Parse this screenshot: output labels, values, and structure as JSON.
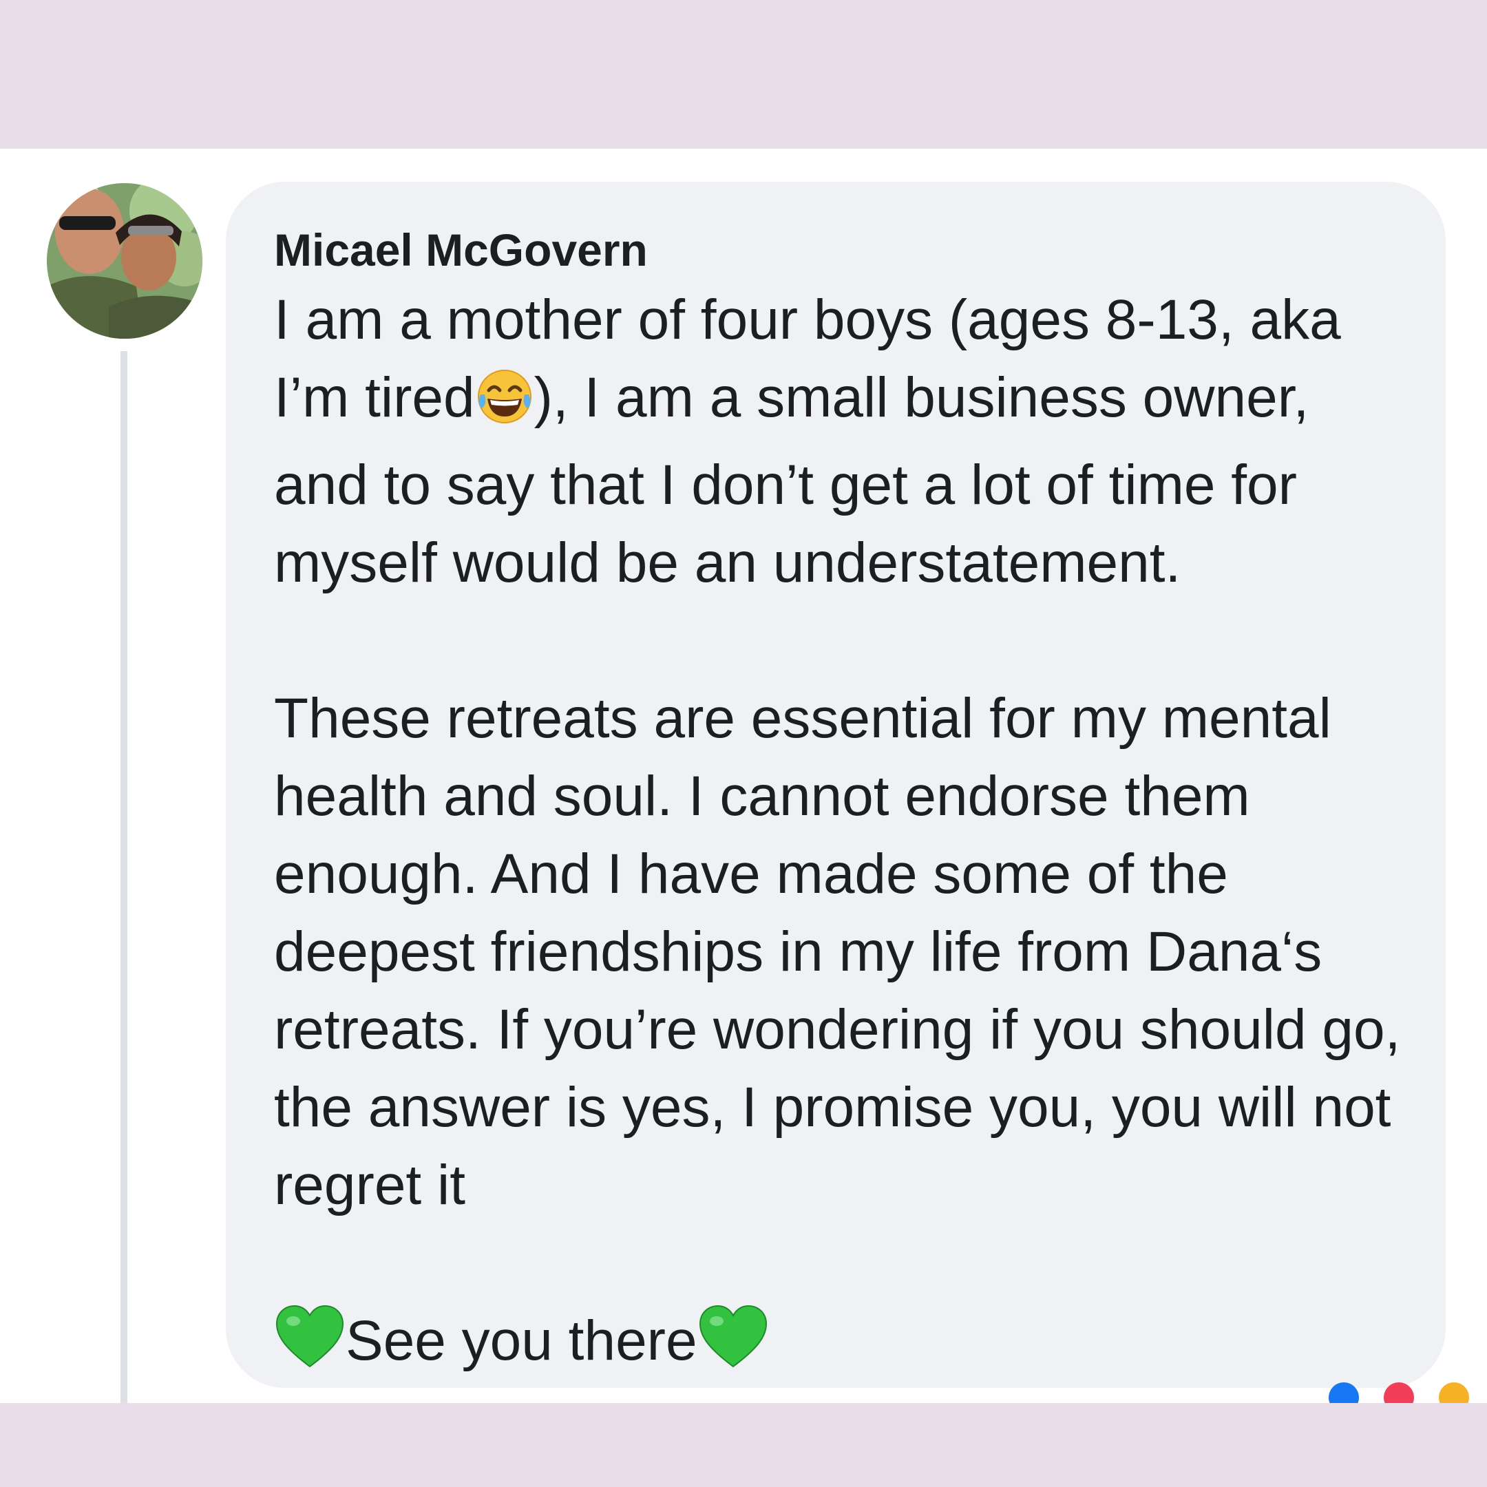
{
  "comment": {
    "author": "Micael McGovern",
    "avatar_icon": "profile-photo-couple",
    "paragraph1": {
      "before_icon": "I am a mother of four boys (ages 8-13, aka I’m tired",
      "icon": "face-with-tears-of-joy-emoji",
      "after_icon": "), I am a small business owner, and to say that I don’t get a lot of time for myself would be an understatement."
    },
    "paragraph2": "These retreats are essential for my mental health and soul. I cannot endorse them enough. And I have made some of the deepest friendships in my life from Dana‘s retreats. If you’re wondering if you should go, the answer is yes, I promise you, you will not regret it",
    "closing": {
      "left_icon": "green-heart-emoji",
      "text": "See you there",
      "right_icon": "green-heart-emoji"
    }
  },
  "colors": {
    "frame_background": "#e8dde9",
    "card_background": "#ffffff",
    "bubble_background": "#f0f1f5",
    "text": "#1c1e21",
    "thread_line": "#dde1e6",
    "heart": "#33c23f"
  }
}
